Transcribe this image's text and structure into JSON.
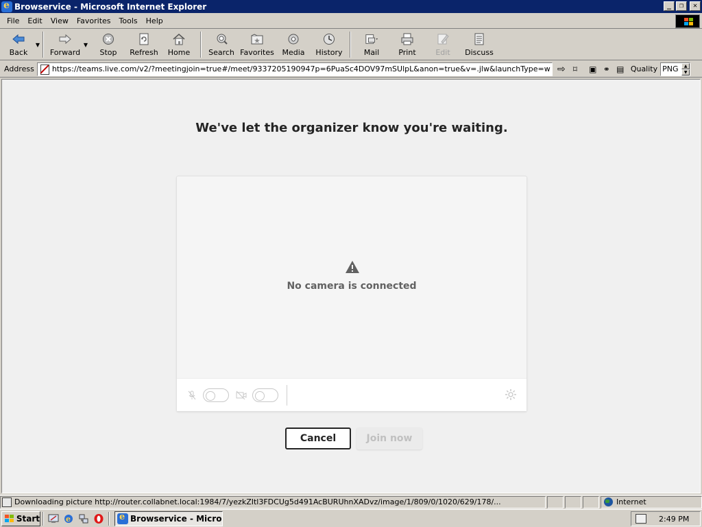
{
  "window": {
    "title": "Browservice - Microsoft Internet Explorer",
    "buttons": {
      "minimize": "_",
      "restore": "❐",
      "close": "✕"
    }
  },
  "menu": [
    "File",
    "Edit",
    "View",
    "Favorites",
    "Tools",
    "Help"
  ],
  "toolbar": {
    "back": "Back",
    "forward": "Forward",
    "stop": "Stop",
    "refresh": "Refresh",
    "home": "Home",
    "search": "Search",
    "favorites": "Favorites",
    "media": "Media",
    "history": "History",
    "mail": "Mail",
    "print": "Print",
    "edit": "Edit",
    "discuss": "Discuss"
  },
  "address": {
    "label": "Address",
    "url": "https://teams.live.com/v2/?meetingjoin=true#/meet/9337205190947p=6PuaSc4DOV97mSUlpL&anon=true&v=.jlw&launchType=w",
    "quality_label": "Quality",
    "quality_value": "PNG"
  },
  "page": {
    "heading": "We've let the organizer know you're waiting.",
    "no_camera": "No camera is connected",
    "cancel": "Cancel",
    "join": "Join now"
  },
  "status": {
    "text": "Downloading picture http://router.collabnet.local:1984/7/yezkZItl3FDCUg5d491AcBURUhnXADvz/image/1/809/0/1020/629/178/...",
    "zone": "Internet"
  },
  "taskbar": {
    "start": "Start",
    "task": "Browservice - Micro...",
    "clock": "2:49 PM"
  },
  "colors": {
    "titlebar": "#0a246a",
    "page_bg": "#f0f0f0",
    "heading": "#242424",
    "disabled": "#c0c0c0"
  }
}
